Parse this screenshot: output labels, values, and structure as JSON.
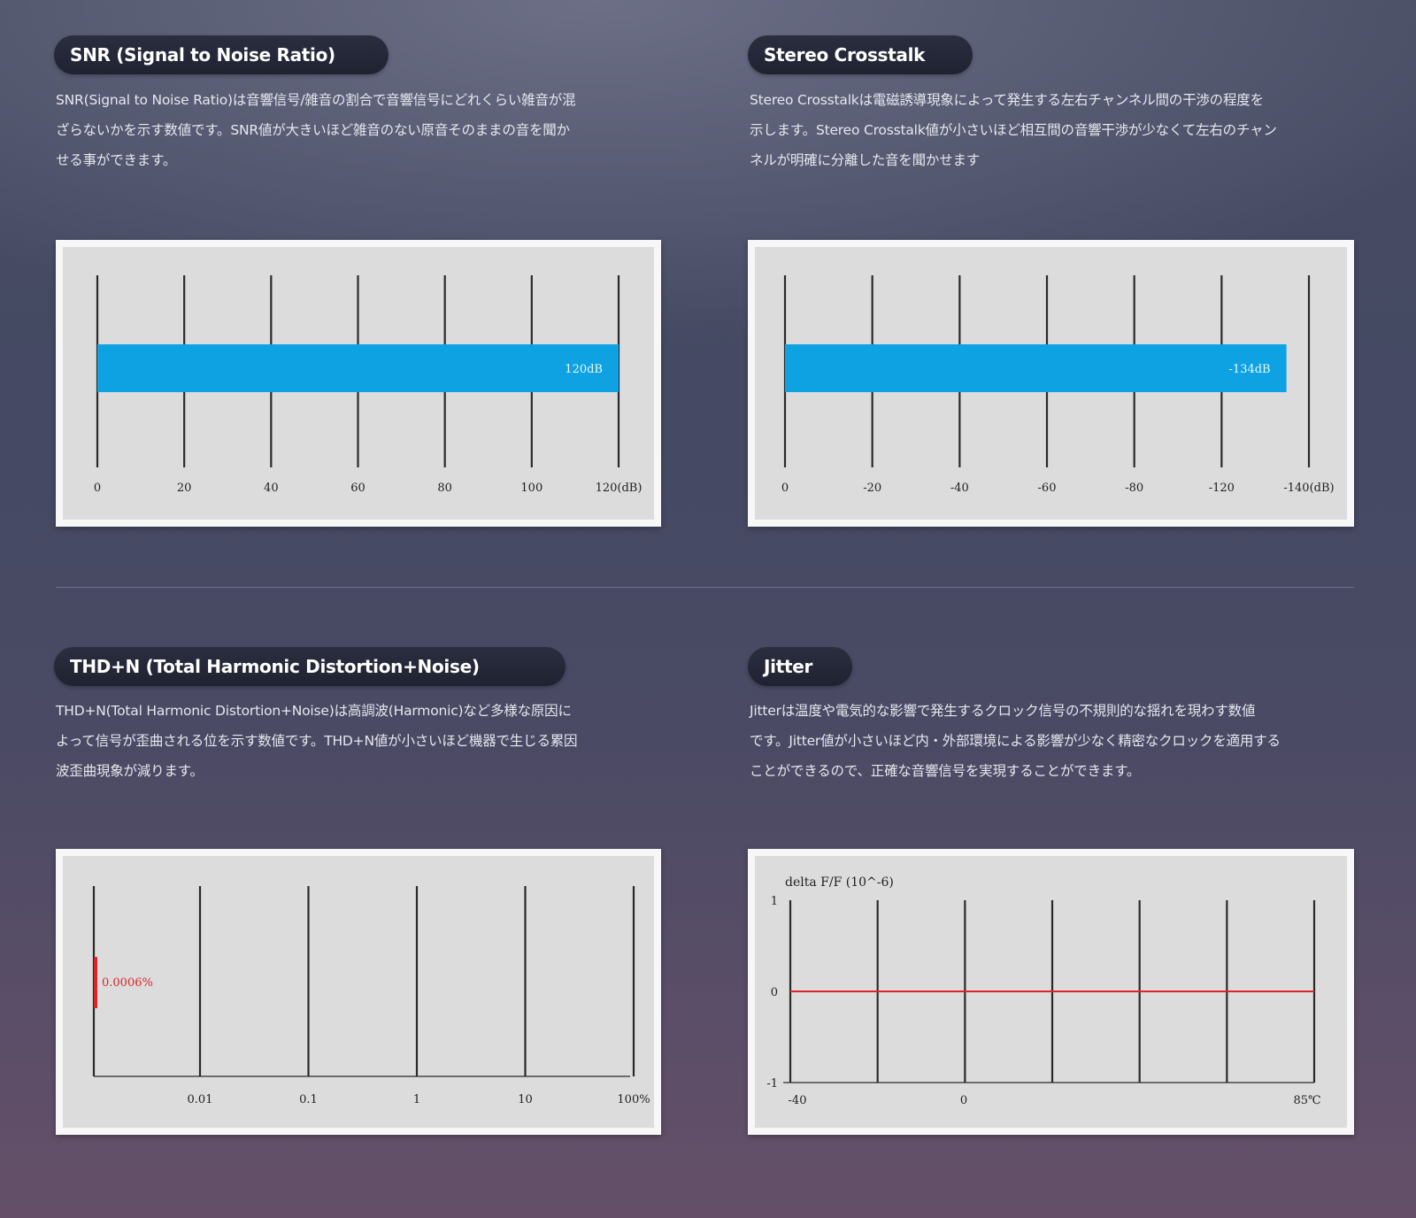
{
  "sections": {
    "snr": {
      "title": "SNR (Signal to Noise Ratio)",
      "description": [
        "SNR(Signal to Noise Ratio)は音響信号/雑音の割合で音響信号にどれくらい雑音が混",
        "ざらないかを示す数値です。SNR値が大きいほど雑音のない原音そのままの音を聞か",
        "せる事ができます。"
      ]
    },
    "crosstalk": {
      "title": "Stereo Crosstalk",
      "description": [
        "Stereo Crosstalkは電磁誘導現象によって発生する左右チャンネル間の干渉の程度を",
        "示します。Stereo Crosstalk値が小さいほど相互間の音響干渉が少なくて左右のチャン",
        "ネルが明確に分離した音を聞かせます"
      ]
    },
    "thdn": {
      "title": "THD+N (Total Harmonic Distortion+Noise)",
      "description": [
        "THD+N(Total Harmonic Distortion+Noise)は高調波(Harmonic)など多様な原因に",
        "よって信号が歪曲される位を示す数値です。THD+N値が小さいほど機器で生じる累因",
        "波歪曲現象が減ります。"
      ]
    },
    "jitter": {
      "title": "Jitter",
      "description": [
        "Jitterは温度や電気的な影響で発生するクロック信号の不規則的な揺れを現わす数値",
        "です。Jitter値が小さいほど内・外部環境による影響が少なく精密なクロックを適用する",
        "ことができるので、正確な音響信号を実現することができます。"
      ]
    }
  },
  "colors": {
    "bar_blue": "#0ea2e2",
    "line_red": "#d8262b",
    "gridline": "#2a2a2a",
    "panel_bg": "#dcdcdc"
  },
  "chart_data": [
    {
      "id": "snr",
      "type": "bar",
      "orientation": "horizontal",
      "tick_labels": [
        "0",
        "20",
        "40",
        "60",
        "80",
        "100",
        "120(dB)"
      ],
      "ticks": [
        0,
        20,
        40,
        60,
        80,
        100,
        120
      ],
      "xlim": [
        0,
        120
      ],
      "value": 120,
      "value_label": "120dB",
      "grid": true
    },
    {
      "id": "crosstalk",
      "type": "bar",
      "orientation": "horizontal",
      "tick_labels": [
        "0",
        "-20",
        "-40",
        "-60",
        "-80",
        "-120",
        "-140(dB)"
      ],
      "ticks": [
        0,
        -20,
        -40,
        -60,
        -80,
        -120,
        -140
      ],
      "xlim": [
        0,
        -140
      ],
      "value": -134,
      "value_label": "-134dB",
      "grid": true
    },
    {
      "id": "thdn",
      "type": "bar",
      "orientation": "horizontal",
      "x_scale": "log",
      "tick_labels": [
        "0.01",
        "0.1",
        "1",
        "10",
        "100%"
      ],
      "ticks": [
        0.01,
        0.1,
        1,
        10,
        100
      ],
      "value": 0.0006,
      "value_label": "0.0006%",
      "grid": true
    },
    {
      "id": "jitter",
      "type": "line",
      "ylabel": "delta F/F (10^-6)",
      "y_ticks": [
        "1",
        "0",
        "-1"
      ],
      "ylim": [
        -1,
        1
      ],
      "x_tick_labels": [
        "-40",
        "0",
        "85℃"
      ],
      "x": [
        -40,
        85
      ],
      "y": [
        0,
        0
      ],
      "grid": true
    }
  ]
}
